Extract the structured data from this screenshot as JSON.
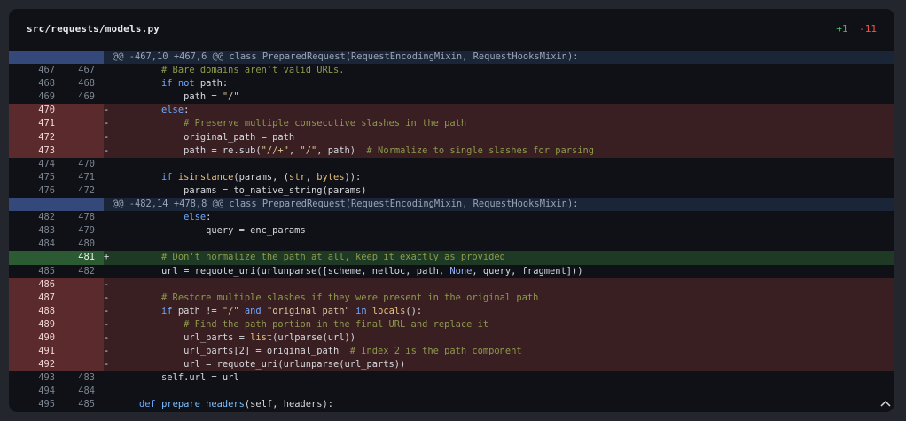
{
  "file": {
    "path": "src/requests/models.py",
    "additions": "+1",
    "deletions": "-11"
  },
  "colors": {
    "addition": "#3fb950",
    "deletion": "#f85149",
    "hunk_gutter": "#34487a",
    "hunk_bg": "#1b2538",
    "del_bg": "#3a1f22",
    "add_bg": "#1f3a24"
  },
  "rows": [
    {
      "type": "hunk",
      "old": "",
      "new": "",
      "mark": "",
      "code": "@@ -467,10 +467,6 @@ class PreparedRequest(RequestEncodingMixin, RequestHooksMixin):"
    },
    {
      "type": "ctx",
      "old": "467",
      "new": "467",
      "mark": "",
      "code": "        # Bare domains aren't valid URLs."
    },
    {
      "type": "ctx",
      "old": "468",
      "new": "468",
      "mark": "",
      "code": "        if not path:"
    },
    {
      "type": "ctx",
      "old": "469",
      "new": "469",
      "mark": "",
      "code": "            path = \"/\""
    },
    {
      "type": "del",
      "old": "470",
      "new": "",
      "mark": "-",
      "code": "        else:"
    },
    {
      "type": "del",
      "old": "471",
      "new": "",
      "mark": "-",
      "code": "            # Preserve multiple consecutive slashes in the path"
    },
    {
      "type": "del",
      "old": "472",
      "new": "",
      "mark": "-",
      "code": "            original_path = path"
    },
    {
      "type": "del",
      "old": "473",
      "new": "",
      "mark": "-",
      "code": "            path = re.sub(\"//+\", \"/\", path)  # Normalize to single slashes for parsing"
    },
    {
      "type": "ctx",
      "old": "474",
      "new": "470",
      "mark": "",
      "code": ""
    },
    {
      "type": "ctx",
      "old": "475",
      "new": "471",
      "mark": "",
      "code": "        if isinstance(params, (str, bytes)):"
    },
    {
      "type": "ctx",
      "old": "476",
      "new": "472",
      "mark": "",
      "code": "            params = to_native_string(params)"
    },
    {
      "type": "hunk",
      "old": "",
      "new": "",
      "mark": "",
      "code": "@@ -482,14 +478,8 @@ class PreparedRequest(RequestEncodingMixin, RequestHooksMixin):"
    },
    {
      "type": "ctx",
      "old": "482",
      "new": "478",
      "mark": "",
      "code": "            else:"
    },
    {
      "type": "ctx",
      "old": "483",
      "new": "479",
      "mark": "",
      "code": "                query = enc_params"
    },
    {
      "type": "ctx",
      "old": "484",
      "new": "480",
      "mark": "",
      "code": ""
    },
    {
      "type": "add",
      "old": "",
      "new": "481",
      "mark": "+",
      "code": "        # Don't normalize the path at all, keep it exactly as provided"
    },
    {
      "type": "ctx",
      "old": "485",
      "new": "482",
      "mark": "",
      "code": "        url = requote_uri(urlunparse([scheme, netloc, path, None, query, fragment]))"
    },
    {
      "type": "del",
      "old": "486",
      "new": "",
      "mark": "-",
      "code": ""
    },
    {
      "type": "del",
      "old": "487",
      "new": "",
      "mark": "-",
      "code": "        # Restore multiple slashes if they were present in the original path"
    },
    {
      "type": "del",
      "old": "488",
      "new": "",
      "mark": "-",
      "code": "        if path != \"/\" and \"original_path\" in locals():"
    },
    {
      "type": "del",
      "old": "489",
      "new": "",
      "mark": "-",
      "code": "            # Find the path portion in the final URL and replace it"
    },
    {
      "type": "del",
      "old": "490",
      "new": "",
      "mark": "-",
      "code": "            url_parts = list(urlparse(url))"
    },
    {
      "type": "del",
      "old": "491",
      "new": "",
      "mark": "-",
      "code": "            url_parts[2] = original_path  # Index 2 is the path component"
    },
    {
      "type": "del",
      "old": "492",
      "new": "",
      "mark": "-",
      "code": "            url = requote_uri(urlunparse(url_parts))"
    },
    {
      "type": "ctx",
      "old": "493",
      "new": "483",
      "mark": "",
      "code": "        self.url = url"
    },
    {
      "type": "ctx",
      "old": "494",
      "new": "484",
      "mark": "",
      "code": ""
    },
    {
      "type": "ctx",
      "old": "495",
      "new": "485",
      "mark": "",
      "code": "    def prepare_headers(self, headers):"
    }
  ],
  "collapse_icon": "chevron-up-icon"
}
